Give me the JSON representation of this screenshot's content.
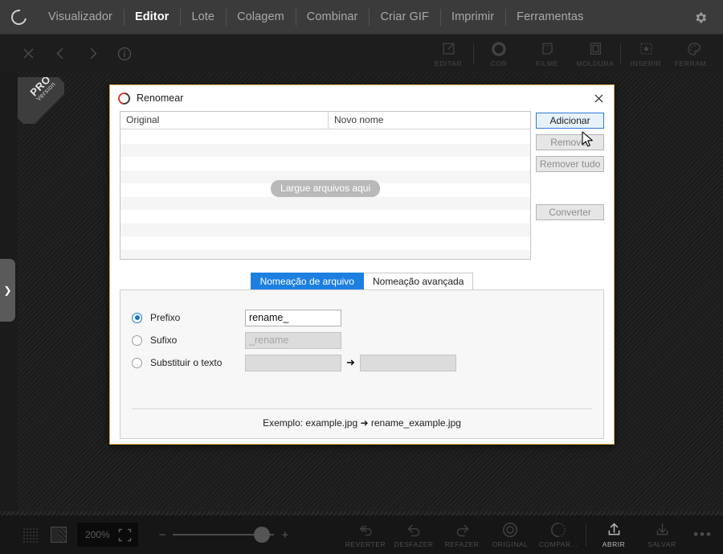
{
  "menubar": {
    "logo_icon": "app-swirl-logo",
    "items": [
      {
        "label": "Visualizador",
        "active": false
      },
      {
        "label": "Editor",
        "active": true
      },
      {
        "label": "Lote",
        "active": false
      },
      {
        "label": "Colagem",
        "active": false
      },
      {
        "label": "Combinar",
        "active": false
      },
      {
        "label": "Criar GIF",
        "active": false
      },
      {
        "label": "Imprimir",
        "active": false
      },
      {
        "label": "Ferramentas",
        "active": false
      }
    ],
    "settings_icon": "gear-icon"
  },
  "toolbar": {
    "left_icons": [
      "close-icon",
      "chevron-left-icon",
      "chevron-right-icon",
      "info-icon"
    ],
    "tools": [
      {
        "label": "EDITAR",
        "icon": "pencil-square-icon"
      },
      {
        "label": "COR",
        "icon": "color-circle-icon"
      },
      {
        "label": "FILME",
        "icon": "film-strip-icon"
      },
      {
        "label": "MOLDURA",
        "icon": "frame-icon"
      },
      {
        "label": "INSERIR",
        "icon": "insert-star-icon"
      },
      {
        "label": "FERRAM...",
        "icon": "palette-icon"
      }
    ]
  },
  "canvas": {
    "pro_badge_line1": "PRO",
    "pro_badge_line2": "Version",
    "panel_handle_icon": "chevron-right-icon"
  },
  "dialog": {
    "title": "Renomear",
    "logo_icon": "app-swirl-logo",
    "close_icon": "close-icon",
    "file_list": {
      "columns": [
        "Original",
        "Novo nome"
      ],
      "rows": [],
      "drop_hint": "Largue arquivos aqui"
    },
    "buttons": [
      {
        "label": "Adicionar",
        "state": "primary"
      },
      {
        "label": "Remover",
        "state": "disabled"
      },
      {
        "label": "Remover tudo",
        "state": "disabled"
      },
      {
        "label": "Converter",
        "state": "disabled"
      }
    ],
    "tabs": [
      {
        "label": "Nomeação de arquivo",
        "active": true
      },
      {
        "label": "Nomeação avançada",
        "active": false
      }
    ],
    "options": {
      "prefix": {
        "label": "Prefixo",
        "selected": true,
        "value": "rename_",
        "placeholder": ""
      },
      "suffix": {
        "label": "Sufixo",
        "selected": false,
        "value": "",
        "placeholder": "_rename"
      },
      "replace": {
        "label": "Substituir o texto",
        "selected": false,
        "from_value": "",
        "from_placeholder": "",
        "to_value": "",
        "to_placeholder": "",
        "arrow": "➜"
      }
    },
    "example": "Exemplo: example.jpg ➜ rename_example.jpg",
    "accent_color": "#1d7fe0",
    "border_color": "#d9a441"
  },
  "bottombar": {
    "grid_icon": "grid-dots-icon",
    "checker_icon": "transparency-icon",
    "zoom_level": "200%",
    "fit_icon": "fit-screen-icon",
    "zoom_out_label": "−",
    "zoom_in_label": "+",
    "tools": [
      {
        "label": "REVERTER",
        "icon": "revert-icon",
        "highlighted": false
      },
      {
        "label": "DESFAZER",
        "icon": "undo-icon",
        "highlighted": false
      },
      {
        "label": "REFAZER",
        "icon": "redo-icon",
        "highlighted": false
      },
      {
        "label": "ORIGINAL",
        "icon": "original-circle-icon",
        "highlighted": false
      },
      {
        "label": "COMPAR...",
        "icon": "compare-icon",
        "highlighted": false
      },
      {
        "label": "ABRIR",
        "icon": "open-upload-icon",
        "highlighted": true
      },
      {
        "label": "SALVAR",
        "icon": "save-download-icon",
        "highlighted": false
      }
    ],
    "more_label": "•••"
  }
}
